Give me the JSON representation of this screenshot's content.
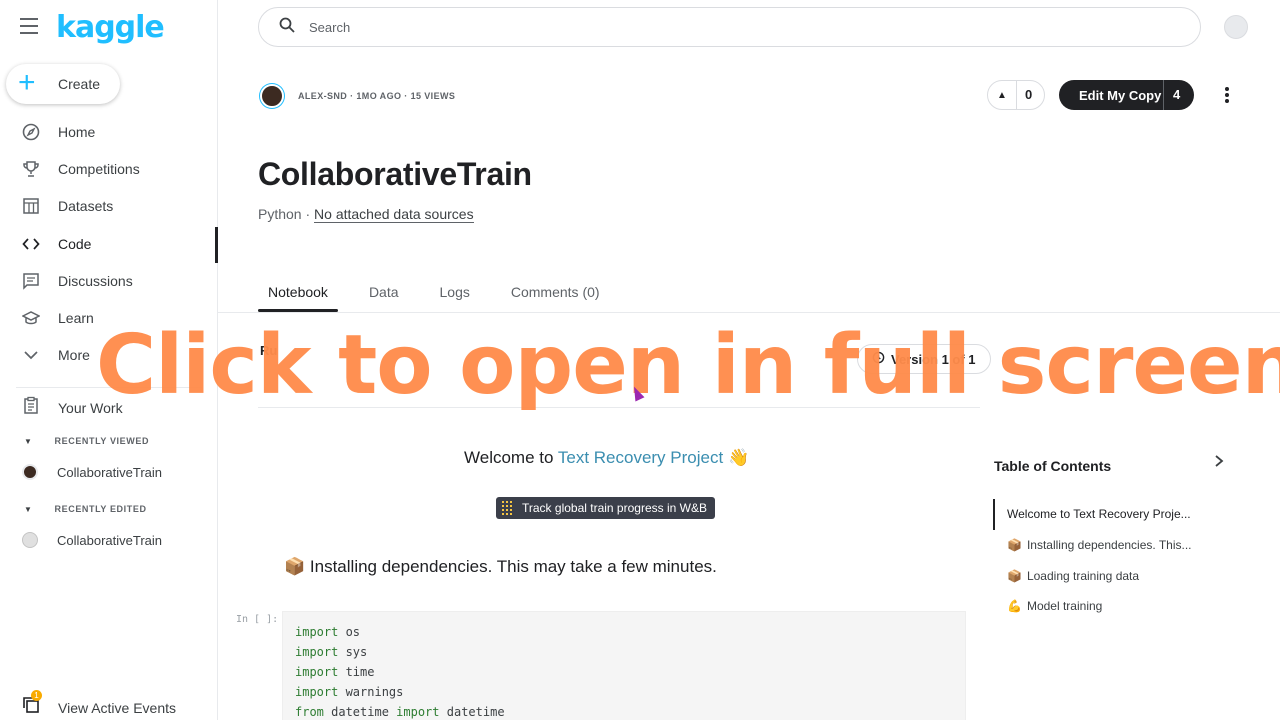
{
  "sidebar": {
    "logo": "kaggle",
    "create_label": "Create",
    "items": [
      {
        "label": "Home",
        "icon": "compass-icon"
      },
      {
        "label": "Competitions",
        "icon": "trophy-icon"
      },
      {
        "label": "Datasets",
        "icon": "table-icon"
      },
      {
        "label": "Code",
        "icon": "code-icon",
        "active": true
      },
      {
        "label": "Discussions",
        "icon": "chat-icon"
      },
      {
        "label": "Learn",
        "icon": "school-icon"
      },
      {
        "label": "More",
        "icon": "chevron-down-icon"
      }
    ],
    "your_work": "Your Work",
    "recently_viewed_heading": "RECENTLY VIEWED",
    "recently_viewed_item": "CollaborativeTrain",
    "recently_edited_heading": "RECENTLY EDITED",
    "recently_edited_item": "CollaborativeTrain",
    "events_label": "View Active Events",
    "events_badge": "1"
  },
  "header": {
    "search_placeholder": "Search"
  },
  "notebook": {
    "meta": "ALEX-SND · 1MO AGO · 15 VIEWS",
    "votes": "0",
    "edit_label": "Edit My Copy",
    "edit_count": "4",
    "title": "CollaborativeTrain",
    "language": "Python · ",
    "data_sources": "No attached data sources",
    "tabs": [
      "Notebook",
      "Data",
      "Logs",
      "Comments (0)"
    ],
    "run_label": "Ru",
    "version_label": "Version 1 of 1"
  },
  "content": {
    "welcome_prefix": "Welcome to ",
    "welcome_link": "Text Recovery Project",
    "welcome_emoji": "👋",
    "wb_badge": "Track global train progress in W&B",
    "install_emoji": "📦",
    "install_text": "Installing dependencies. This may take a few minutes.",
    "cell_prompt": "In [ ]:",
    "code_lines": [
      {
        "kw": "import",
        "rest": " os"
      },
      {
        "kw": "import",
        "rest": " sys"
      },
      {
        "kw": "import",
        "rest": " time"
      },
      {
        "kw": "import",
        "rest": " warnings"
      },
      {
        "kw": "from",
        "rest": " datetime ",
        "kw2": "import",
        "rest2": " datetime"
      }
    ]
  },
  "toc": {
    "title": "Table of Contents",
    "items": [
      {
        "emoji": "",
        "label": "Welcome to Text Recovery Proje..."
      },
      {
        "emoji": "📦",
        "label": "Installing dependencies. This..."
      },
      {
        "emoji": "📦",
        "label": "Loading training data"
      },
      {
        "emoji": "💪",
        "label": "Model training"
      }
    ]
  },
  "overlay": {
    "text": "Click to open in full screen"
  },
  "colors": {
    "brand": "#20beff",
    "overlay": "#ff8c4b",
    "link": "#3b8eb0"
  }
}
